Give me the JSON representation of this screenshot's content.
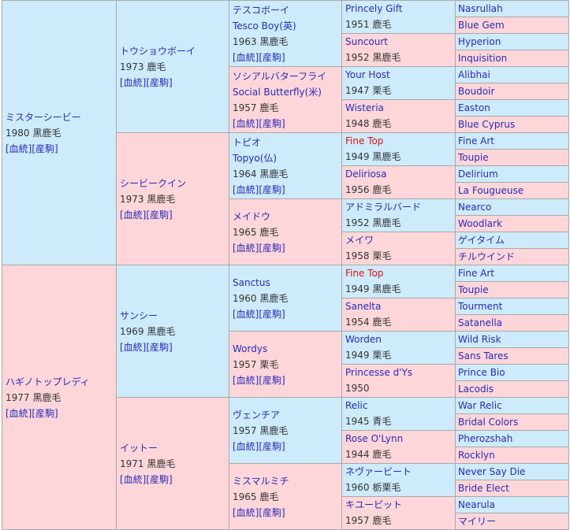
{
  "g1": [
    {
      "name": "ミスターシービー",
      "info": "1980 黒鹿毛",
      "links": "[血統][産駒]"
    },
    {
      "name": "ハギノトップレディ",
      "info": "1977 黒鹿毛",
      "links": "[血統][産駒]"
    }
  ],
  "g2": [
    {
      "name": "トウショウボーイ",
      "info": "1973 鹿毛",
      "links": "[血統][産駒]"
    },
    {
      "name": "シービークイン",
      "info": "1973 黒鹿毛",
      "links": "[血統][産駒]"
    },
    {
      "name": "サンシー",
      "info": "1969 黒鹿毛",
      "links": "[血統][産駒]"
    },
    {
      "name": "イットー",
      "info": "1971 黒鹿毛",
      "links": "[血統][産駒]"
    }
  ],
  "g3": [
    {
      "name": "テスコボーイ",
      "sub": "Tesco Boy(英)",
      "info": "1963 黒鹿毛",
      "links": "[血統][産駒]"
    },
    {
      "name": "ソシアルバターフライ",
      "sub": "Social Butterfly(米)",
      "info": "1957 鹿毛",
      "links": "[血統][産駒]"
    },
    {
      "name": "トピオ",
      "sub": "Topyo(仏)",
      "info": "1964 黒鹿毛",
      "links": "[血統][産駒]"
    },
    {
      "name": "メイドウ",
      "info": "1965 鹿毛",
      "links": "[血統][産駒]"
    },
    {
      "name": "Sanctus",
      "info": "1960 黒鹿毛",
      "links": "[血統][産駒]"
    },
    {
      "name": "Wordys",
      "info": "1957 栗毛",
      "links": "[血統][産駒]"
    },
    {
      "name": "ヴェンチア",
      "info": "1957 黒鹿毛",
      "links": "[血統][産駒]"
    },
    {
      "name": "ミスマルミチ",
      "info": "1965 鹿毛",
      "links": "[血統][産駒]"
    }
  ],
  "g4": [
    {
      "name": "Princely Gift",
      "info": "1951 鹿毛"
    },
    {
      "name": "Suncourt",
      "info": "1952 黒鹿毛"
    },
    {
      "name": "Your Host",
      "info": "1947 栗毛"
    },
    {
      "name": "Wisteria",
      "info": "1948 鹿毛"
    },
    {
      "name": "Fine Top",
      "info": "1949 黒鹿毛",
      "highlight": true
    },
    {
      "name": "Deliriosa",
      "info": "1956 鹿毛"
    },
    {
      "name": "アドミラルバード",
      "info": "1952 黒鹿毛"
    },
    {
      "name": "メイワ",
      "info": "1958 栗毛"
    },
    {
      "name": "Fine Top",
      "info": "1949 黒鹿毛",
      "highlight": true
    },
    {
      "name": "Sanelta",
      "info": "1954 鹿毛"
    },
    {
      "name": "Worden",
      "info": "1949 栗毛"
    },
    {
      "name": "Princesse d'Ys",
      "info": "1950"
    },
    {
      "name": "Relic",
      "info": "1945 青毛"
    },
    {
      "name": "Rose O'Lynn",
      "info": "1944 鹿毛"
    },
    {
      "name": "ネヴァービート",
      "info": "1960 栃栗毛"
    },
    {
      "name": "キユーピット",
      "info": "1957 鹿毛"
    }
  ],
  "g5": [
    "Nasrullah",
    "Blue Gem",
    "Hyperion",
    "Inquisition",
    "Alibhai",
    "Boudoir",
    "Easton",
    "Blue Cyprus",
    "Fine Art",
    "Toupie",
    "Delirium",
    "La Fougueuse",
    "Nearco",
    "Woodlark",
    "ゲイタイム",
    "チルウインド",
    "Fine Art",
    "Toupie",
    "Tourment",
    "Satanella",
    "Wild Risk",
    "Sans Tares",
    "Prince Bio",
    "Lacodis",
    "War Relic",
    "Bridal Colors",
    "Pherozshah",
    "Rocklyn",
    "Never Say Die",
    "Bride Elect",
    "Nearula",
    "マイリー"
  ],
  "colors": {
    "sire_bg": "#cdebfa",
    "dam_bg": "#fcd6d9",
    "link": "#2a2ab8",
    "highlight": "#dd1111",
    "border": "#a9a9a9"
  }
}
